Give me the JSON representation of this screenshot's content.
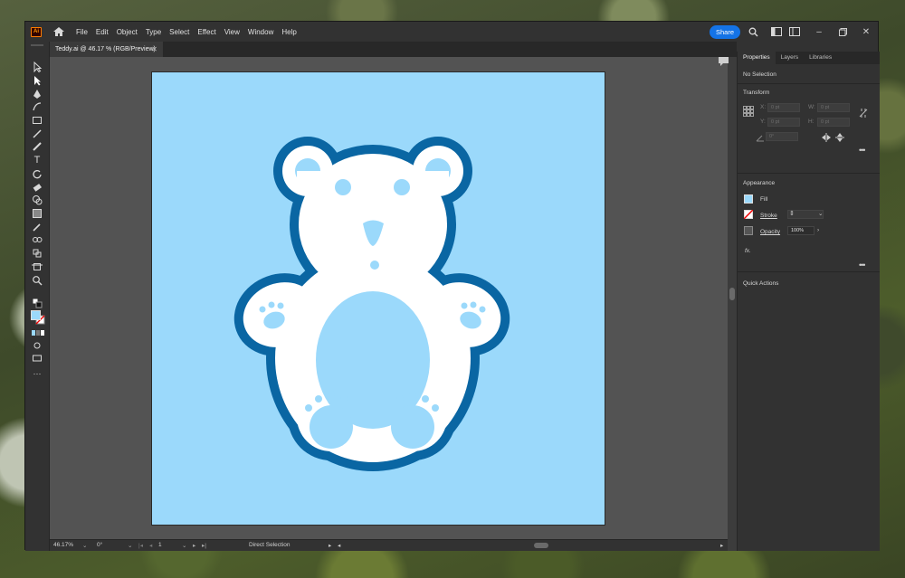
{
  "app": {
    "logo_text": "Ai",
    "menus": [
      "File",
      "Edit",
      "Object",
      "Type",
      "Select",
      "Effect",
      "View",
      "Window",
      "Help"
    ],
    "share_label": "Share",
    "accent": "#1473e6"
  },
  "document": {
    "tab_title": "Teddy.ai @ 46.17 % (RGB/Preview)",
    "artboard_color": "#9bd9fb",
    "bear_outline_color": "#0a66a3",
    "bear_fill_color": "#ffffff"
  },
  "status": {
    "zoom": "46.17%",
    "rotation": "0°",
    "artboard_number": "1",
    "tool_name": "Direct Selection"
  },
  "panel": {
    "tabs": [
      "Properties",
      "Layers",
      "Libraries"
    ],
    "selection_state": "No Selection",
    "transform_title": "Transform",
    "x_label": "X:",
    "x_value": "0 pt",
    "y_label": "Y:",
    "y_value": "0 pt",
    "w_label": "W:",
    "w_value": "0 pt",
    "h_label": "H:",
    "h_value": "0 pt",
    "angle_value": "0°",
    "appearance_title": "Appearance",
    "fill_label": "Fill",
    "stroke_label": "Stroke",
    "opacity_label": "Opacity",
    "opacity_value": "100%",
    "fx_label": "fx.",
    "quick_actions_title": "Quick Actions"
  }
}
